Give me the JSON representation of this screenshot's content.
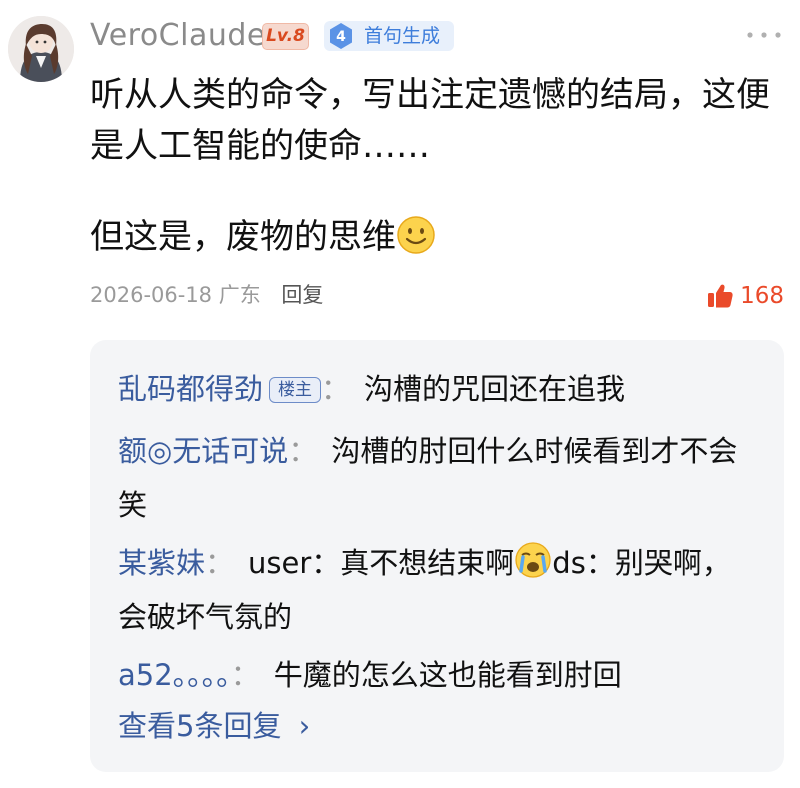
{
  "comment": {
    "username": "VeroClaude",
    "level_badge": "Lv.8",
    "first_badge": {
      "number": "4",
      "label": "首句生成"
    },
    "paragraph1": "听从人类的命令，写出注定遗憾的结局，这便是人工智能的使命……",
    "paragraph2": "但这是，废物的思维",
    "date": "2026-06-18",
    "location": "广东",
    "reply_label": "回复",
    "like_count": "168"
  },
  "replies": [
    {
      "name": "乱码都得劲",
      "badge": "楼主",
      "colon": "：",
      "text": "沟槽的咒回还在追我"
    },
    {
      "name": "额◎无话可说",
      "colon": "：",
      "text": "沟槽的肘回什么时候看到才不会笑"
    },
    {
      "name": "某紫妹",
      "colon": "：",
      "text_before_icon": "user：真不想结束啊",
      "text_after_icon": "ds：别哭啊，会破坏气氛的"
    },
    {
      "name": "a52。。。。",
      "colon": "：",
      "text": "牛魔的怎么这也能看到肘回"
    }
  ],
  "view_more": "查看5条回复",
  "colors": {
    "accent_red": "#ea4a2a",
    "reply_name": "#3a5c9e",
    "badge_blue": "#3d7ddb"
  }
}
